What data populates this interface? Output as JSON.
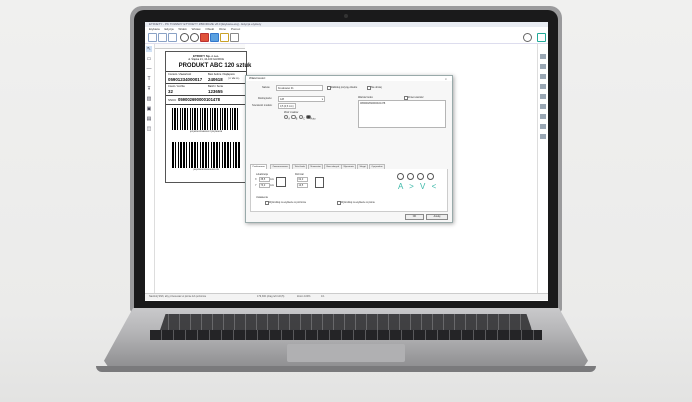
{
  "window": {
    "title": "ETIKIETY - PK TOWARY ETYKIETY ZBIORCZE  v8.0 [Etykieta.etq] - Edycja etykiety"
  },
  "menu": [
    "Etykieta",
    "Edycja",
    "Widok",
    "Wstaw",
    "Obiekt",
    "Okno",
    "Pomoc"
  ],
  "label": {
    "company": "ETROFY Sp. z o.o.",
    "address": "ul. Śląska 21, 44-100 GLIWICE",
    "product": "PRODUKT ABC 120 sztuk",
    "content_h": "Content / Zawartość",
    "content_v": "05901234000017",
    "best_h": "Best before / Najlepsze",
    "best_v": "240618",
    "best_suffix": "(YY MM DD)",
    "count_h": "Count / Liczba",
    "count_v": "32",
    "batch_h": "Batch / Seria",
    "batch_v": "123655",
    "sscc_h": "SSCC",
    "sscc_v": "059002690000101478",
    "bc1_text": "(02)05901234000017(15)240618",
    "bc2_text": "(00)059002690000101478"
  },
  "dialog": {
    "title": "Właściwości",
    "name_label": "Nazwa:",
    "name_value": "Kreskowiec 01",
    "lock_label": "Zablokuj pozycję obiektu",
    "hide_label": "Nie drukuj",
    "type_label": "Rodzaj kodu:",
    "type_value": "128",
    "module_label": "Szerokość modułu:",
    "module_value": "0,5 (0,5 mm)",
    "field_label": "Zbiór znaków",
    "field_options": [
      "A",
      "B",
      "C",
      "Auto"
    ],
    "code_label": "Wartość kodu:",
    "code_value": "0059002690000101478",
    "code_check": "Zmień wartość",
    "tabs": [
      "Podstawowe",
      "Zaawansowane",
      "Tekst kodu",
      "Numerator",
      "Baza danych",
      "Wyrażenie",
      "Skrypt",
      "Opcjonalne"
    ],
    "location_label": "Lokalizacja",
    "x_label": "X",
    "x_value": "38,5",
    "y_label": "Y",
    "y_value": "73,0",
    "unit": "mm",
    "size_label": "Rozmiar",
    "w_value": "62,0",
    "h_value": "10,5",
    "anchor_label": "Ustawienia",
    "opt1": "Wyśrodkuj na etykiecie w poziomie",
    "opt2": "Wyśrodkuj na etykiecie w pionie",
    "arrows": "A > V <",
    "ok": "OK",
    "cancel": "Anuluj"
  },
  "status": {
    "text": "Naciśnij Shift, aby przesuwać w pionie lub poziomie",
    "coords": "179,300 (drag left 120,5)",
    "zoom": "Zoom 100%",
    "page": "1/1"
  },
  "colors": {
    "accent": "#2f7fd6",
    "arrow": "#3bb8a8"
  }
}
